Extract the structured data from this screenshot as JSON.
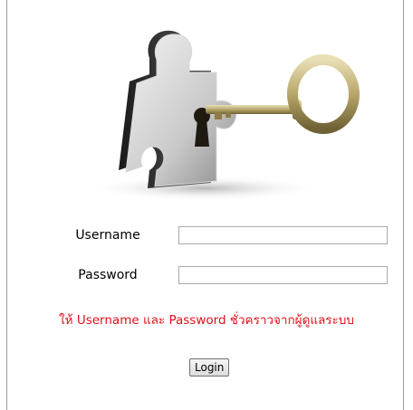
{
  "login": {
    "username_label": "Username",
    "password_label": "Password",
    "username_value": "",
    "password_value": "",
    "notice": "ให้ Username และ Password ชั่วคราวจากผู้ดูแลระบบ",
    "login_button": "Login"
  },
  "colors": {
    "notice": "#e0101a"
  },
  "icons": {
    "logo": "puzzle-key-logo"
  }
}
